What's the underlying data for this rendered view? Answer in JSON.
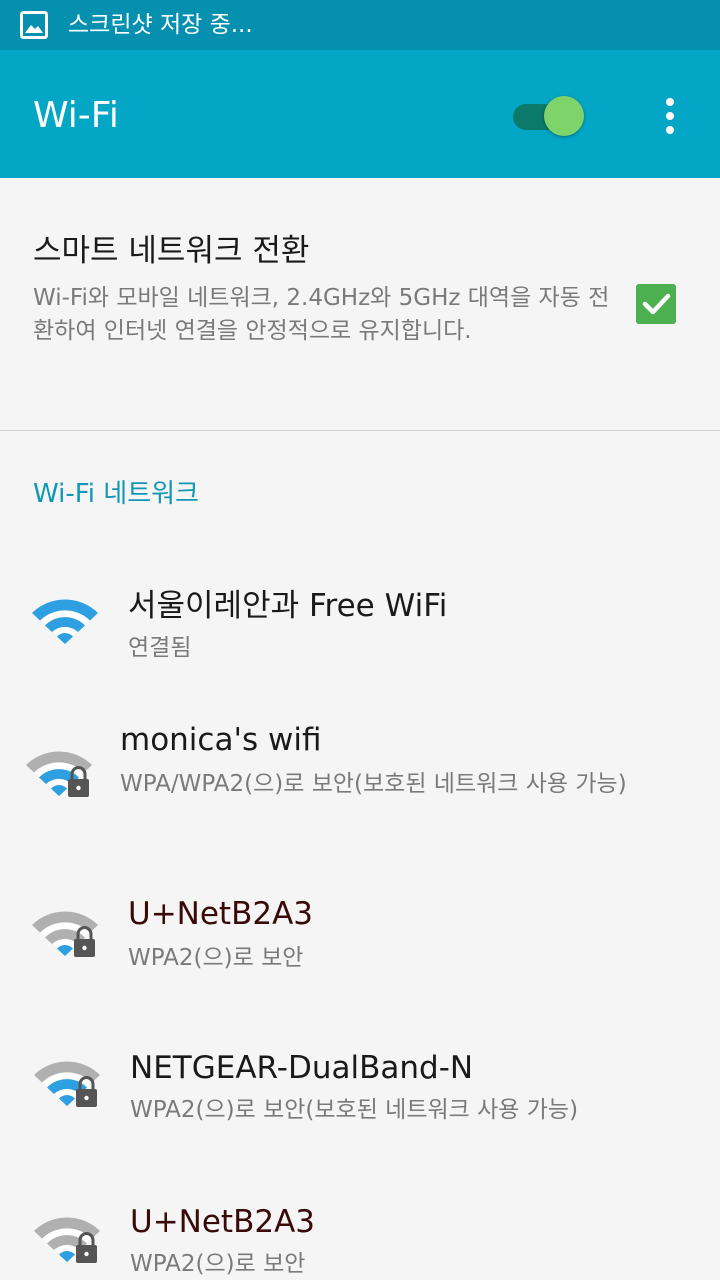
{
  "status_bar": {
    "icon": "image-icon",
    "text": "스크린샷 저장 중..."
  },
  "app_bar": {
    "title": "Wi-Fi",
    "toggle_on": true,
    "more_icon": "more-vert-icon"
  },
  "smart_switch": {
    "title": "스마트 네트워크 전환",
    "description": "Wi-Fi와 모바일 네트워크, 2.4GHz와 5GHz 대역을 자동 전환하여 인터넷 연결을 안정적으로 유지합니다.",
    "checked": true
  },
  "networks_header": "Wi-Fi 네트워크",
  "networks": [
    {
      "name": "서울이레안과 Free WiFi",
      "status": "연결됨",
      "secured": false,
      "connected": true,
      "icon": "wifi-connected-icon"
    },
    {
      "name": "monica's wifi",
      "status": "WPA/WPA2(으)로 보안(보호된 네트워크 사용 가능)",
      "secured": true,
      "connected": false,
      "icon": "wifi-locked-icon"
    },
    {
      "name": "U+NetB2A3",
      "status": "WPA2(으)로 보안",
      "secured": true,
      "connected": false,
      "icon": "wifi-locked-icon"
    },
    {
      "name": "NETGEAR-DualBand-N",
      "status": "WPA2(으)로 보안(보호된 네트워크 사용 가능)",
      "secured": true,
      "connected": false,
      "icon": "wifi-locked-icon"
    },
    {
      "name": "U+NetB2A3",
      "status": "WPA2(으)로 보안",
      "secured": true,
      "connected": false,
      "icon": "wifi-locked-icon"
    }
  ],
  "colors": {
    "status_bar": "#0590b0",
    "app_bar": "#04a6c5",
    "accent": "#1197b5",
    "toggle_thumb": "#7ed36b",
    "checkbox": "#4caf50",
    "wifi_blue": "#2e9fe0",
    "wifi_gray": "#b0b0b0",
    "lock": "#555555"
  }
}
